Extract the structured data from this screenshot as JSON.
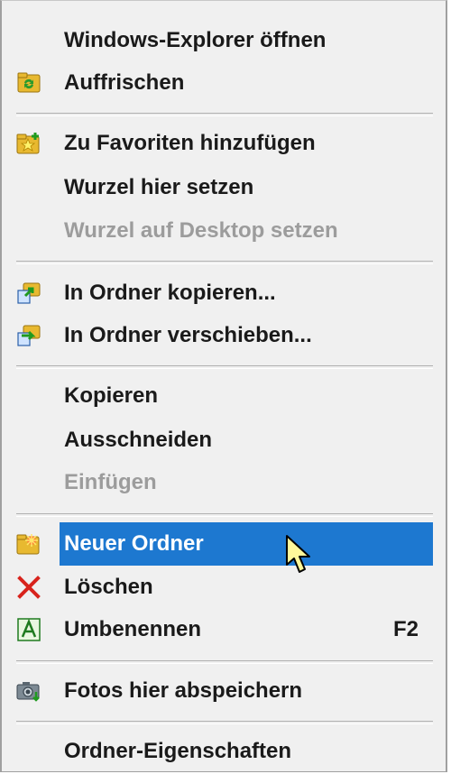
{
  "menu": {
    "items": [
      {
        "label": "Windows-Explorer öffnen",
        "icon": "none",
        "enabled": true
      },
      {
        "label": "Auffrischen",
        "icon": "refresh-folder-icon",
        "enabled": true
      },
      {
        "label": "Zu Favoriten hinzufügen",
        "icon": "favorite-star-folder-icon",
        "enabled": true
      },
      {
        "label": "Wurzel hier setzen",
        "icon": "none",
        "enabled": true
      },
      {
        "label": "Wurzel auf Desktop setzen",
        "icon": "none",
        "enabled": false
      },
      {
        "label": "In Ordner kopieren...",
        "icon": "copy-to-folder-icon",
        "enabled": true
      },
      {
        "label": "In Ordner verschieben...",
        "icon": "move-to-folder-icon",
        "enabled": true
      },
      {
        "label": "Kopieren",
        "icon": "none",
        "enabled": true
      },
      {
        "label": "Ausschneiden",
        "icon": "none",
        "enabled": true
      },
      {
        "label": "Einfügen",
        "icon": "none",
        "enabled": false
      },
      {
        "label": "Neuer Ordner",
        "icon": "new-folder-icon",
        "enabled": true,
        "highlighted": true
      },
      {
        "label": "Löschen",
        "icon": "delete-x-icon",
        "enabled": true
      },
      {
        "label": "Umbenennen",
        "icon": "rename-icon",
        "enabled": true,
        "shortcut": "F2"
      },
      {
        "label": "Fotos hier abspeichern",
        "icon": "camera-icon",
        "enabled": true
      },
      {
        "label": "Ordner-Eigenschaften",
        "icon": "none",
        "enabled": true
      }
    ]
  },
  "colors": {
    "highlight": "#1d78d0",
    "disabled_text": "#9c9c9c",
    "menu_background": "#f0f0f0"
  }
}
